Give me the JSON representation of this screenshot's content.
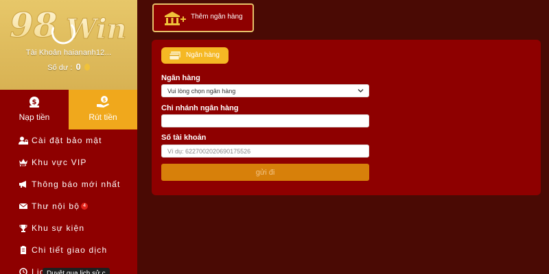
{
  "account": {
    "logo_text": "98Win",
    "name": "Tài Khoản haiananh12...",
    "balance_label": "Số dư :",
    "balance_value": "0"
  },
  "tabs": [
    {
      "label": "Nạp tiền",
      "icon": "dollar-bag-icon"
    },
    {
      "label": "Rút tiền",
      "icon": "hand-money-icon"
    }
  ],
  "menu": [
    {
      "label": "Cài đặt bảo mật",
      "icon": "user-lock-icon"
    },
    {
      "label": "Khu vực VIP",
      "icon": "vip-crown-icon"
    },
    {
      "label": "Thông báo mới nhất",
      "icon": "megaphone-icon"
    },
    {
      "label": "Thư nội bộ",
      "icon": "mail-icon",
      "badge": "4"
    },
    {
      "label": "Khu sự kiện",
      "icon": "trophy-icon"
    },
    {
      "label": "Chi tiết giao dịch",
      "icon": "clipboard-icon"
    },
    {
      "label": "Lịc",
      "icon": "history-icon"
    }
  ],
  "tooltip": "Duyệt qua lịch sử c",
  "top": {
    "add_bank_label": "Thêm ngân hàng",
    "add_bank_icon": "bank-plus-icon"
  },
  "panel": {
    "pill_label": "Ngân hàng",
    "bank_label": "Ngân hàng",
    "bank_select_value": "Vui lòng chọn ngân hàng",
    "branch_label": "Chi nhánh ngân hàng",
    "branch_value": "",
    "account_label": "Số tài khoản",
    "account_placeholder": "Ví dụ: 6227002020690175526",
    "submit_label": "gửi đi"
  },
  "colors": {
    "background": "#4a0a04",
    "panel": "#8e0000",
    "gold": "#e7c769",
    "active_tab": "#f0a81c",
    "pill": "#f5b824",
    "submit": "#d7800a"
  }
}
